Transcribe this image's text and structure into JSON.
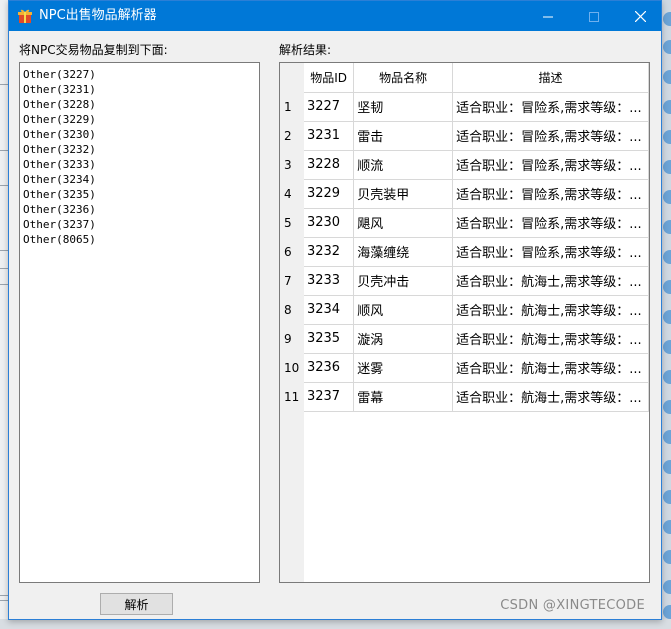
{
  "window": {
    "title": "NPC出售物品解析器",
    "controls": {
      "minimize": "minimize",
      "maximize": "maximize",
      "close": "close"
    }
  },
  "left_panel": {
    "label": "将NPC交易物品复制到下面:",
    "input_lines": [
      "Other(3227)",
      "Other(3231)",
      "Other(3228)",
      "Other(3229)",
      "Other(3230)",
      "Other(3232)",
      "Other(3233)",
      "Other(3234)",
      "Other(3235)",
      "Other(3236)",
      "Other(3237)",
      "Other(8065)"
    ]
  },
  "right_panel": {
    "label": "解析结果:",
    "columns": [
      "物品ID",
      "物品名称",
      "描述"
    ],
    "rows": [
      {
        "row": "1",
        "id": "3227",
        "name": "坚韧",
        "desc": "适合职业：冒险系,需求等级：..."
      },
      {
        "row": "2",
        "id": "3231",
        "name": "雷击",
        "desc": "适合职业：冒险系,需求等级：..."
      },
      {
        "row": "3",
        "id": "3228",
        "name": "顺流",
        "desc": "适合职业：冒险系,需求等级：..."
      },
      {
        "row": "4",
        "id": "3229",
        "name": "贝壳装甲",
        "desc": "适合职业：冒险系,需求等级：..."
      },
      {
        "row": "5",
        "id": "3230",
        "name": "飓风",
        "desc": "适合职业：冒险系,需求等级：..."
      },
      {
        "row": "6",
        "id": "3232",
        "name": "海藻缠绕",
        "desc": "适合职业：冒险系,需求等级：..."
      },
      {
        "row": "7",
        "id": "3233",
        "name": "贝壳冲击",
        "desc": "适合职业：航海士,需求等级：..."
      },
      {
        "row": "8",
        "id": "3234",
        "name": "顺风",
        "desc": "适合职业：航海士,需求等级：..."
      },
      {
        "row": "9",
        "id": "3235",
        "name": "漩涡",
        "desc": "适合职业：航海士,需求等级：..."
      },
      {
        "row": "10",
        "id": "3236",
        "name": "迷雾",
        "desc": "适合职业：航海士,需求等级：..."
      },
      {
        "row": "11",
        "id": "3237",
        "name": "雷幕",
        "desc": "适合职业：航海士,需求等级：..."
      }
    ]
  },
  "actions": {
    "parse_label": "解析"
  },
  "watermark": "CSDN @XINGTECODE",
  "colors": {
    "titlebar": "#0078d7",
    "window_bg": "#f0f0f0"
  }
}
